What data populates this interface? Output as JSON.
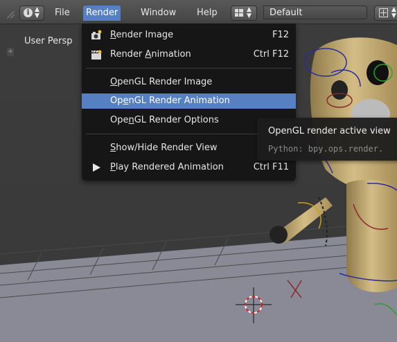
{
  "header": {
    "info_icon": "info-icon",
    "menus": [
      {
        "label": "File"
      },
      {
        "label": "Render"
      },
      {
        "label": "Window"
      },
      {
        "label": "Help"
      }
    ],
    "layout_icon": "screen-layout-icon",
    "layout_name": "Default",
    "add_icon": "add-screen-icon"
  },
  "viewport": {
    "label": "User Persp",
    "toggle_label": "+"
  },
  "render_menu": {
    "items": [
      {
        "label_pre": "",
        "label_ul": "R",
        "label_post": "ender Image",
        "shortcut": "F12",
        "icon": "camera-icon"
      },
      {
        "label_pre": "Render ",
        "label_ul": "A",
        "label_post": "nimation",
        "shortcut": "Ctrl F12",
        "icon": "clapperboard-icon"
      },
      {
        "label_pre": "",
        "label_ul": "O",
        "label_post": "penGL Render Image",
        "shortcut": ""
      },
      {
        "label_pre": "Op",
        "label_ul": "e",
        "label_post": "nGL Render Animation",
        "shortcut": ""
      },
      {
        "label_pre": "Ope",
        "label_ul": "n",
        "label_post": "GL Render Options",
        "shortcut": ""
      },
      {
        "label_pre": "",
        "label_ul": "S",
        "label_post": "how/Hide Render View",
        "shortcut": ""
      },
      {
        "label_pre": "",
        "label_ul": "P",
        "label_post": "lay Rendered Animation",
        "shortcut": "Ctrl F11",
        "icon": "play-icon"
      }
    ]
  },
  "tooltip": {
    "title": "OpenGL render active view",
    "python": "Python: bpy.ops.render."
  },
  "colors": {
    "highlight": "#5680c2",
    "menu_bg": "#141414",
    "header_bg": "#4e4e4e"
  }
}
